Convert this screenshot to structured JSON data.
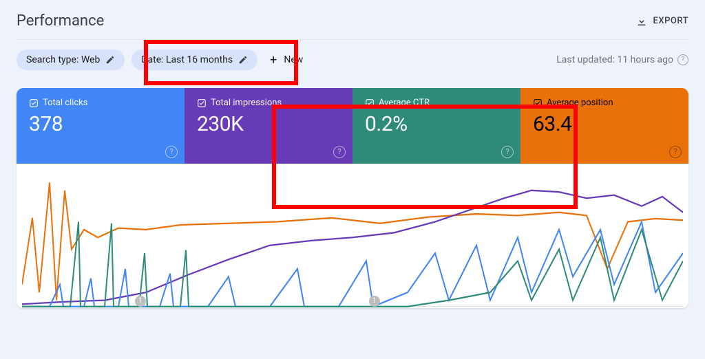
{
  "header": {
    "title": "Performance",
    "export_label": "EXPORT"
  },
  "filters": {
    "search_type": "Search type: Web",
    "date": "Date: Last 16 months",
    "new_label": "New",
    "last_updated": "Last updated: 11 hours ago"
  },
  "metrics": {
    "clicks": {
      "label": "Total clicks",
      "value": "378"
    },
    "impressions": {
      "label": "Total impressions",
      "value": "230K"
    },
    "ctr": {
      "label": "Average CTR",
      "value": "0.2%"
    },
    "position": {
      "label": "Average position",
      "value": "63.4"
    }
  },
  "chart_data": {
    "type": "line",
    "xlabel": "",
    "ylabel": "",
    "xlim": [
      0,
      960
    ],
    "ylim": [
      0,
      170
    ],
    "series": [
      {
        "name": "Total clicks",
        "color": "#4285f4"
      },
      {
        "name": "Total impressions",
        "color": "#673ab7"
      },
      {
        "name": "Average CTR",
        "color": "#2e8b7a"
      },
      {
        "name": "Average position",
        "color": "#e8710a"
      }
    ],
    "note": "Four overlaid daily time-series over ~16 months. Values are approximate pixel readings; no numeric axis ticks are shown.",
    "annotations": [
      "1",
      "1"
    ]
  }
}
